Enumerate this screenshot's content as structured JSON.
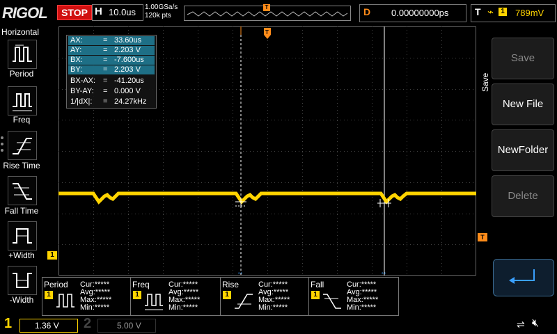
{
  "header": {
    "logo": "RIGOL",
    "run_state": "STOP",
    "horizontal_label": "H",
    "timebase": "10.0us",
    "sample_rate": "1.00GSa/s",
    "memory_depth": "120k pts",
    "delay_label": "D",
    "delay_value": "0.00000000ps",
    "trigger_label": "T",
    "trigger_source": "1",
    "trigger_level": "789mV"
  },
  "left_panel": {
    "title": "Horizontal",
    "items": [
      {
        "label": "Period",
        "icon": "period-icon"
      },
      {
        "label": "Freq",
        "icon": "freq-icon"
      },
      {
        "label": "Rise Time",
        "icon": "rise-time-icon"
      },
      {
        "label": "Fall Time",
        "icon": "fall-time-icon"
      },
      {
        "label": "+Width",
        "icon": "positive-width-icon"
      },
      {
        "label": "-Width",
        "icon": "negative-width-icon"
      }
    ]
  },
  "cursor_readout": {
    "rows": [
      {
        "key": "AX:",
        "eq": "=",
        "value": "33.60us",
        "highlight": true
      },
      {
        "key": "AY:",
        "eq": "=",
        "value": "2.203 V",
        "highlight": true
      },
      {
        "key": "BX:",
        "eq": "=",
        "value": "-7.600us",
        "highlight": true
      },
      {
        "key": "BY:",
        "eq": "=",
        "value": "2.203 V",
        "highlight": true
      },
      {
        "key": "BX-AX:",
        "eq": "=",
        "value": "-41.20us",
        "highlight": false
      },
      {
        "key": "BY-AY:",
        "eq": "=",
        "value": "0.000 V",
        "highlight": false
      },
      {
        "key": "1/|dX|:",
        "eq": "=",
        "value": "24.27kHz",
        "highlight": false
      }
    ]
  },
  "right_panel": {
    "tab_label": "Save",
    "buttons": [
      {
        "label": "Save",
        "enabled": false
      },
      {
        "label": "New File",
        "enabled": true
      },
      {
        "label": "NewFolder",
        "enabled": true
      },
      {
        "label": "Delete",
        "enabled": false
      }
    ],
    "enter_icon": "enter-arrow-icon"
  },
  "markers": {
    "trigger_position": "T",
    "channel1_ground": "1",
    "trigger_level_marker": "T"
  },
  "measurements": [
    {
      "name": "Period",
      "channel": "1",
      "cur": "Cur:*****",
      "avg": "Avg:*****",
      "max": "Max:*****",
      "min": "Min:*****"
    },
    {
      "name": "Freq",
      "channel": "1",
      "cur": "Cur:*****",
      "avg": "Avg:*****",
      "max": "Max:*****",
      "min": "Min:*****"
    },
    {
      "name": "Rise",
      "channel": "1",
      "cur": "Cur:*****",
      "avg": "Avg:*****",
      "max": "Max:*****",
      "min": "Min:*****"
    },
    {
      "name": "Fall",
      "channel": "1",
      "cur": "Cur:*****",
      "avg": "Avg:*****",
      "max": "Max:*****",
      "min": "Min:*****"
    }
  ],
  "channels": {
    "ch1_number": "1",
    "ch1_scale": "1.36 V",
    "ch2_number": "2",
    "ch2_scale": "5.00 V"
  },
  "colors": {
    "channel1": "#ffd400",
    "stop": "#d01010",
    "trigger": "#ff8c1a",
    "cursor_highlight": "#1e6f86"
  }
}
